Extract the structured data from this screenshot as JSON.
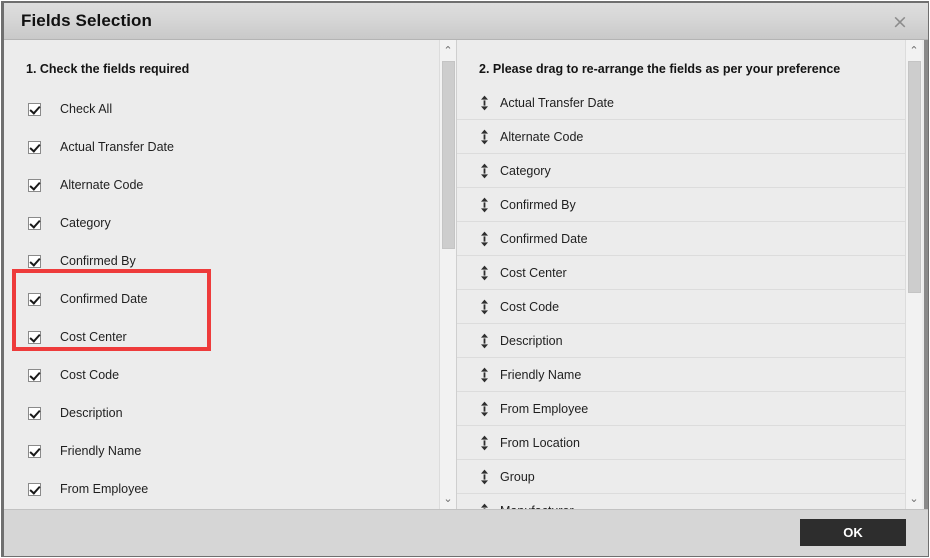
{
  "dialog": {
    "title": "Fields Selection",
    "close_icon": "close-icon",
    "close_glyph": "×"
  },
  "left_panel": {
    "heading": "1. Check the fields required",
    "items": [
      {
        "label": "Check All",
        "checked": true
      },
      {
        "label": "Actual Transfer Date",
        "checked": true
      },
      {
        "label": "Alternate Code",
        "checked": true
      },
      {
        "label": "Category",
        "checked": true
      },
      {
        "label": "Confirmed By",
        "checked": true
      },
      {
        "label": "Confirmed Date",
        "checked": true
      },
      {
        "label": "Cost Center",
        "checked": true
      },
      {
        "label": "Cost Code",
        "checked": true
      },
      {
        "label": "Description",
        "checked": true
      },
      {
        "label": "Friendly Name",
        "checked": true
      },
      {
        "label": "From Employee",
        "checked": true
      }
    ],
    "annotation": {
      "name": "red-highlight-box",
      "color": "#ee3b3b",
      "covers": [
        "Confirmed By",
        "Confirmed Date"
      ]
    },
    "scrollbar": {
      "up_glyph": "⌃",
      "down_glyph": "⌄"
    }
  },
  "right_panel": {
    "heading": "2. Please drag to re-arrange the fields as per your preference",
    "items": [
      {
        "label": "Actual Transfer Date"
      },
      {
        "label": "Alternate Code"
      },
      {
        "label": "Category"
      },
      {
        "label": "Confirmed By"
      },
      {
        "label": "Confirmed Date"
      },
      {
        "label": "Cost Center"
      },
      {
        "label": "Cost Code"
      },
      {
        "label": "Description"
      },
      {
        "label": "Friendly Name"
      },
      {
        "label": "From Employee"
      },
      {
        "label": "From Location"
      },
      {
        "label": "Group"
      },
      {
        "label": "Manufacturer"
      }
    ],
    "drag_handle_icon": "drag-updown-icon",
    "scrollbar": {
      "up_glyph": "⌃",
      "down_glyph": "⌄"
    }
  },
  "footer": {
    "ok_label": "OK"
  }
}
